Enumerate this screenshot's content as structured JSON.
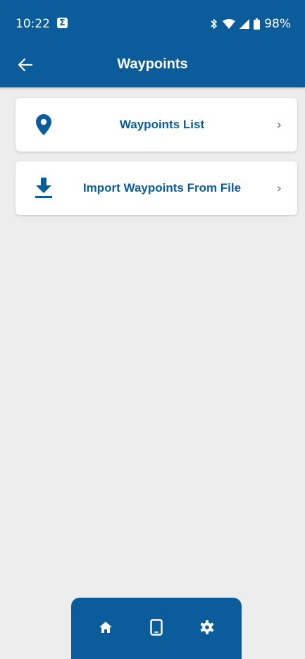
{
  "status_bar": {
    "time": "10:22",
    "notification_glyph": "Σ",
    "battery_percent": "98%",
    "icons": [
      "notification-icon",
      "bluetooth-icon",
      "wifi-icon",
      "signal-icon",
      "battery-icon"
    ]
  },
  "app_bar": {
    "title": "Waypoints",
    "back_icon": "arrow-left-icon"
  },
  "menu": {
    "items": [
      {
        "label": "Waypoints List",
        "icon": "map-pin-icon",
        "chevron": "›"
      },
      {
        "label": "Import Waypoints From File",
        "icon": "download-icon",
        "chevron": "›"
      }
    ]
  },
  "bottom_nav": {
    "items": [
      {
        "icon": "home-icon"
      },
      {
        "icon": "tablet-icon"
      },
      {
        "icon": "gear-icon"
      }
    ]
  },
  "colors": {
    "primary": "#0a5c9b",
    "background": "#ededed",
    "card": "#ffffff"
  }
}
